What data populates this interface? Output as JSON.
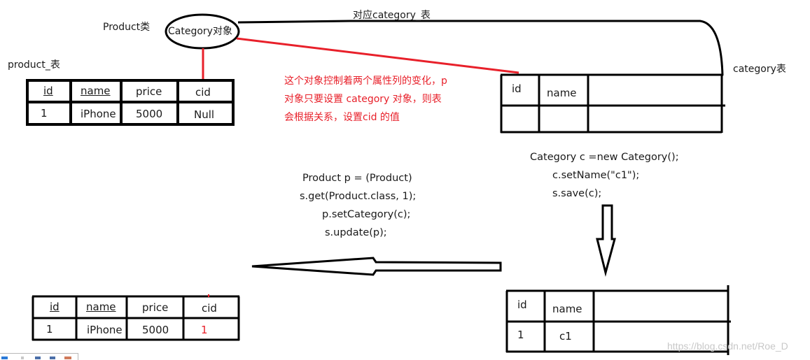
{
  "labels": {
    "product_class": "Product类",
    "category_object": "Category对象",
    "maps_to_category_table": "对应category_表",
    "product_table": "product_表",
    "category_table": "category表"
  },
  "note": {
    "lines": [
      "这个对象控制着两个属性列的变化，p",
      "对象只要设置 category 对象，则表",
      "会根据关系，设置cid 的值"
    ],
    "color": "#e8202a"
  },
  "product_table_before": {
    "headers": [
      "id",
      "name",
      "price",
      "cid"
    ],
    "rows": [
      [
        "1",
        "iPhone",
        "5000",
        "Null"
      ]
    ]
  },
  "category_table_before": {
    "headers": [
      "id",
      "name",
      ""
    ],
    "rows": [
      [
        "",
        "",
        ""
      ]
    ]
  },
  "category_code": [
    "Category c =new Category();",
    "c.setName(\"c1\");",
    "s.save(c);"
  ],
  "product_code": [
    "Product p = (Product)",
    "s.get(Product.class, 1);",
    "p.setCategory(c);",
    "s.update(p);"
  ],
  "product_table_after": {
    "headers": [
      "id",
      "name",
      "price",
      "cid"
    ],
    "rows": [
      [
        "1",
        "iPhone",
        "5000",
        "1"
      ]
    ],
    "highlight_color": "#e8202a"
  },
  "category_table_after": {
    "headers": [
      "id",
      "name",
      ""
    ],
    "rows": [
      [
        "1",
        "c1",
        ""
      ]
    ]
  },
  "watermark": "https://blog.csdn.net/Roe_D",
  "colors": {
    "line": "#000000",
    "relation": "#e8202a"
  }
}
